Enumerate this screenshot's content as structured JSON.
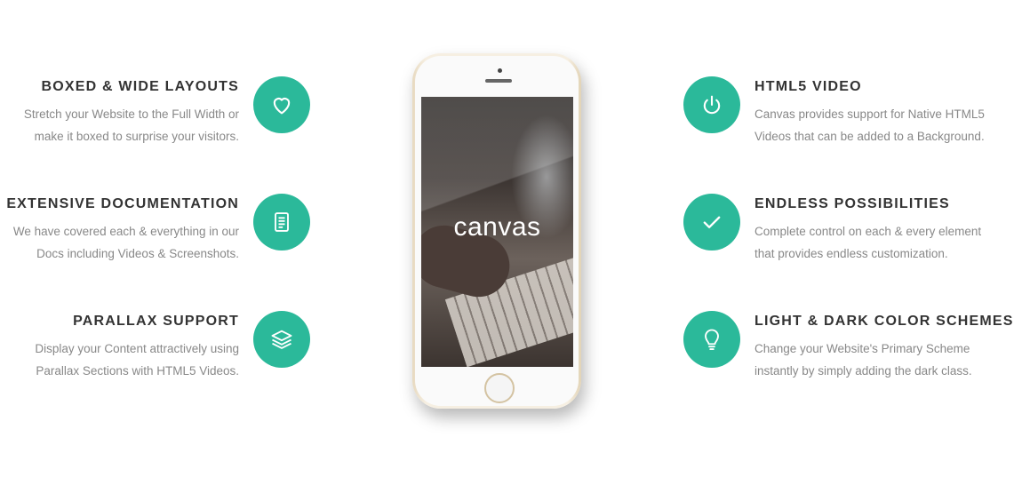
{
  "brand_color": "#2bb99a",
  "features_left": [
    {
      "title": "BOXED & WIDE LAYOUTS",
      "line1": "Stretch your Website to the Full Width or",
      "line2": "make it boxed to surprise your visitors.",
      "icon": "heart-icon"
    },
    {
      "title": "EXTENSIVE DOCUMENTATION",
      "line1": "We have covered each & everything in our",
      "line2": "Docs including Videos & Screenshots.",
      "icon": "document-icon"
    },
    {
      "title": "PARALLAX SUPPORT",
      "line1": "Display your Content attractively using",
      "line2": "Parallax Sections with HTML5 Videos.",
      "icon": "layers-icon"
    }
  ],
  "features_right": [
    {
      "title": "HTML5 VIDEO",
      "line1": "Canvas provides support for Native HTML5",
      "line2": "Videos that can be added to a Background.",
      "icon": "power-icon"
    },
    {
      "title": "ENDLESS POSSIBILITIES",
      "line1": "Complete control on each & every element",
      "line2": "that provides endless customization.",
      "icon": "check-icon"
    },
    {
      "title": "LIGHT & DARK COLOR SCHEMES",
      "line1": "Change your Website's Primary Scheme",
      "line2": "instantly by simply adding the dark class.",
      "icon": "lightbulb-icon"
    }
  ],
  "phone": {
    "screen_logo": "canvas"
  }
}
